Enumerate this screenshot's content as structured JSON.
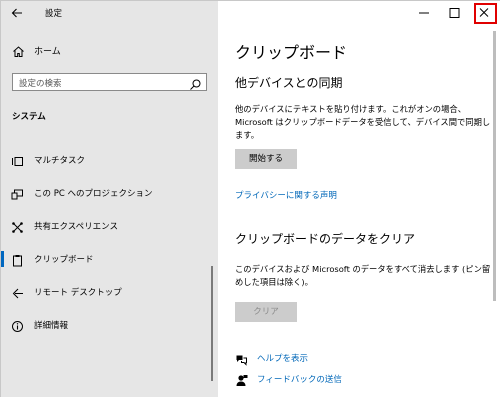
{
  "window": {
    "app_title": "設定",
    "controls": {
      "minimize": "—",
      "maximize": "☐",
      "close": "✕"
    }
  },
  "sidebar": {
    "home_label": "ホーム",
    "search_placeholder": "設定の検索",
    "section_label": "システム",
    "items": [
      {
        "label": "マルチタスク",
        "icon": "multitask-icon"
      },
      {
        "label": "この PC へのプロジェクション",
        "icon": "projection-icon"
      },
      {
        "label": "共有エクスペリエンス",
        "icon": "shared-experience-icon"
      },
      {
        "label": "クリップボード",
        "icon": "clipboard-icon",
        "active": true
      },
      {
        "label": "リモート デスクトップ",
        "icon": "remote-desktop-icon"
      },
      {
        "label": "詳細情報",
        "icon": "info-icon"
      }
    ]
  },
  "main": {
    "title": "クリップボード",
    "sync": {
      "heading": "他デバイスとの同期",
      "description": "他のデバイスにテキストを貼り付けます。これがオンの場合、Microsoft はクリップボードデータを受信して、デバイス間で同期します。",
      "button": "開始する",
      "privacy_link": "プライバシーに関する声明"
    },
    "clear": {
      "heading": "クリップボードのデータをクリア",
      "description": "このデバイスおよび Microsoft のデータをすべて消去します (ピン留めした項目は除く)。",
      "button": "クリア"
    },
    "help": {
      "get_help": "ヘルプを表示",
      "feedback": "フィードバックの送信"
    }
  },
  "colors": {
    "accent": "#0067c0",
    "link": "#0067b8",
    "highlight": "#e00000",
    "sidebar_bg": "#e6e6e6"
  }
}
